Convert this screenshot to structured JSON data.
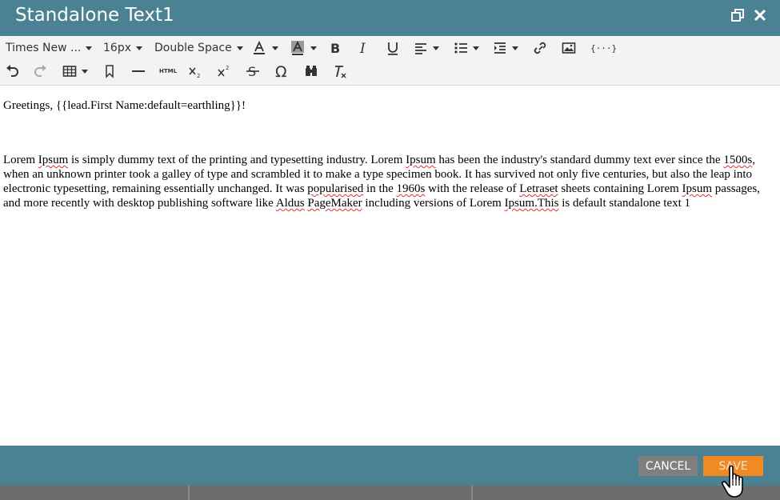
{
  "dialog": {
    "title": "Standalone Text1"
  },
  "toolbar": {
    "font_family": "Times New ...",
    "font_size": "16px",
    "line_spacing": "Double Space",
    "icons_row1": [
      "text-color-icon",
      "background-color-icon",
      "bold-icon",
      "italic-icon",
      "underline-icon",
      "align-icon",
      "list-icon",
      "indent-icon",
      "link-icon",
      "image-icon",
      "token-icon"
    ],
    "icons_row2": [
      "undo-icon",
      "redo-icon",
      "table-icon",
      "bookmark-icon",
      "horizontal-rule-icon",
      "html-icon",
      "subscript-icon",
      "superscript-icon",
      "strikethrough-icon",
      "special-char-icon",
      "find-icon",
      "clear-format-icon"
    ],
    "html_label": "HTML",
    "token_label": "{···}"
  },
  "editor": {
    "greeting": "Greetings, {{lead.First Name:default=earthling}}!",
    "paragraph": {
      "s1": "Lorem ",
      "w1": "Ipsum",
      "s2": " is simply dummy text of the printing and typesetting industry. Lorem ",
      "w2": "Ipsum",
      "s3": " has been the industry's standard dummy text ever since the ",
      "w3": "1500s",
      "s4": ", when an unknown printer took a galley of type and scrambled it to make a type specimen book. It has survived not only five centuries, but also the leap into electronic typesetting, remaining essentially unchanged. It was ",
      "w4": "popularised",
      "s5": " in the ",
      "w5": "1960s",
      "s6": " with the release of ",
      "w6": "Letraset",
      "s7": " sheets containing Lorem ",
      "w7": "Ipsum",
      "s8": " passages, and more recently with desktop publishing software like ",
      "w8": "Aldus",
      "s9": " ",
      "w9": "PageMaker",
      "s10": " including versions of Lorem ",
      "w10": "Ipsum.This",
      "s11": " is default standalone text 1"
    }
  },
  "footer": {
    "cancel_label": "CANCEL",
    "save_label": "SAVE"
  },
  "colors": {
    "header_bg": "#4b8293",
    "save_bg": "#f08a24",
    "cancel_bg": "#7f7f7f",
    "toolbar_bg": "#f3f3f3"
  }
}
